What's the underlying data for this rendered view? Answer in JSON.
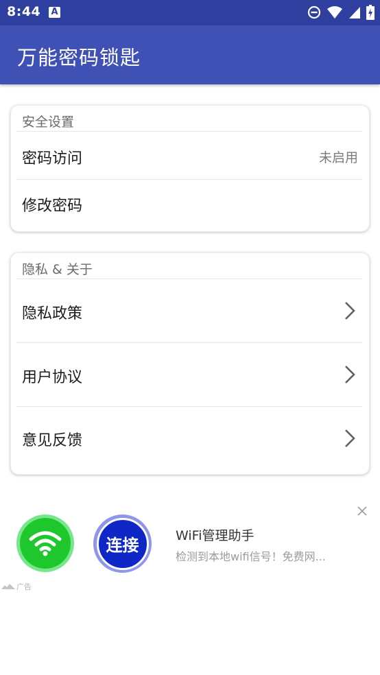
{
  "status_bar": {
    "time": "8:44",
    "app_icon_letter": "A",
    "icons": [
      "dnd-icon",
      "wifi-icon",
      "signal-icon",
      "battery-icon"
    ]
  },
  "app_bar": {
    "title": "万能密码锁匙",
    "background": "#3f51b5"
  },
  "security_section": {
    "header": "安全设置",
    "items": [
      {
        "label": "密码访问",
        "value": "未启用"
      },
      {
        "label": "修改密码"
      }
    ]
  },
  "privacy_section": {
    "header": "隐私 & 关于",
    "items": [
      {
        "label": "隐私政策",
        "icon": "chevron-right-icon"
      },
      {
        "label": "用户协议",
        "icon": "chevron-right-icon"
      },
      {
        "label": "意见反馈",
        "icon": "chevron-right-icon"
      }
    ]
  },
  "ad": {
    "connect_label": "连接",
    "title": "WiFi管理助手",
    "description": "检测到本地wifi信号！免费网...",
    "badge": "广告",
    "close_icon": "close-icon"
  }
}
